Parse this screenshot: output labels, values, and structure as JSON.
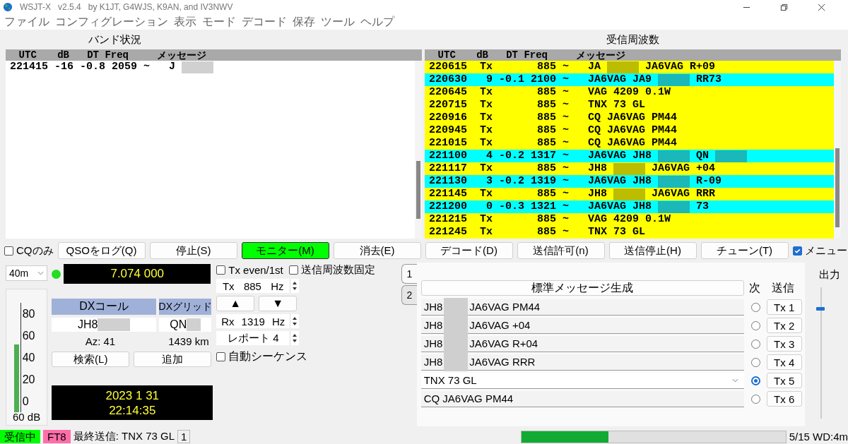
{
  "window": {
    "app": "WSJT-X",
    "version": "v2.5.4",
    "credits": "by K1JT, G4WJS, K9AN, and IV3NWV"
  },
  "menu": [
    "ファイル",
    "コンフィグレーション",
    "表示",
    "モード",
    "デコード",
    "保存",
    "ツール",
    "ヘルプ"
  ],
  "band_activity": {
    "title": "バンド状況",
    "columns": [
      "UTC",
      "dB",
      "DT",
      "Freq",
      "メッセージ"
    ],
    "rows": [
      {
        "kind": "plain",
        "utc": "221415",
        "db": "-16",
        "dt": "-0.8",
        "freq": "2059",
        "sep": "~",
        "message": [
          {
            "kind": "text",
            "text": "J"
          },
          {
            "kind": "redacted"
          }
        ]
      }
    ]
  },
  "rx_frequency": {
    "title": "受信周波数",
    "columns": [
      "UTC",
      "dB",
      "DT",
      "Freq",
      "メッセージ"
    ],
    "rows": [
      {
        "kind": "tx",
        "utc": "220615",
        "db": "Tx",
        "freq": "885",
        "sep": "~",
        "message": [
          {
            "kind": "text",
            "text": "JA"
          },
          {
            "kind": "redacted"
          },
          {
            "kind": "text",
            "text": "JA6VAG R+09"
          }
        ]
      },
      {
        "kind": "rx",
        "utc": "220630",
        "db": "9",
        "dt": "-0.1",
        "freq": "2100",
        "sep": "~",
        "message": [
          {
            "kind": "text",
            "text": "JA6VAG JA9"
          },
          {
            "kind": "redacted"
          },
          {
            "kind": "text",
            "text": "RR73"
          }
        ]
      },
      {
        "kind": "tx",
        "utc": "220645",
        "db": "Tx",
        "freq": "885",
        "sep": "~",
        "message": [
          {
            "kind": "text",
            "text": "VAG 4209 0.1W"
          }
        ]
      },
      {
        "kind": "tx",
        "utc": "220715",
        "db": "Tx",
        "freq": "885",
        "sep": "~",
        "message": [
          {
            "kind": "text",
            "text": "TNX 73 GL"
          }
        ]
      },
      {
        "kind": "tx",
        "utc": "220916",
        "db": "Tx",
        "freq": "885",
        "sep": "~",
        "message": [
          {
            "kind": "text",
            "text": "CQ JA6VAG PM44"
          }
        ]
      },
      {
        "kind": "tx",
        "utc": "220945",
        "db": "Tx",
        "freq": "885",
        "sep": "~",
        "message": [
          {
            "kind": "text",
            "text": "CQ JA6VAG PM44"
          }
        ]
      },
      {
        "kind": "tx",
        "utc": "221015",
        "db": "Tx",
        "freq": "885",
        "sep": "~",
        "message": [
          {
            "kind": "text",
            "text": "CQ JA6VAG PM44"
          }
        ]
      },
      {
        "kind": "rx",
        "utc": "221100",
        "db": "4",
        "dt": "-0.2",
        "freq": "1317",
        "sep": "~",
        "message": [
          {
            "kind": "text",
            "text": "JA6VAG JH8"
          },
          {
            "kind": "redacted"
          },
          {
            "kind": "text",
            "text": "QN"
          },
          {
            "kind": "redacted"
          }
        ]
      },
      {
        "kind": "tx",
        "utc": "221117",
        "db": "Tx",
        "freq": "885",
        "sep": "~",
        "message": [
          {
            "kind": "text",
            "text": "JH8"
          },
          {
            "kind": "redacted"
          },
          {
            "kind": "text",
            "text": "JA6VAG +04"
          }
        ]
      },
      {
        "kind": "rx",
        "utc": "221130",
        "db": "3",
        "dt": "-0.2",
        "freq": "1319",
        "sep": "~",
        "message": [
          {
            "kind": "text",
            "text": "JA6VAG JH8"
          },
          {
            "kind": "redacted"
          },
          {
            "kind": "text",
            "text": "R-09"
          }
        ]
      },
      {
        "kind": "tx",
        "utc": "221145",
        "db": "Tx",
        "freq": "885",
        "sep": "~",
        "message": [
          {
            "kind": "text",
            "text": "JH8"
          },
          {
            "kind": "redacted"
          },
          {
            "kind": "text",
            "text": "JA6VAG RRR"
          }
        ]
      },
      {
        "kind": "rx",
        "utc": "221200",
        "db": "0",
        "dt": "-0.3",
        "freq": "1321",
        "sep": "~",
        "message": [
          {
            "kind": "text",
            "text": "JA6VAG JH8"
          },
          {
            "kind": "redacted"
          },
          {
            "kind": "text",
            "text": "73"
          }
        ]
      },
      {
        "kind": "tx",
        "utc": "221215",
        "db": "Tx",
        "freq": "885",
        "sep": "~",
        "message": [
          {
            "kind": "text",
            "text": "VAG 4209 0.1W"
          }
        ]
      },
      {
        "kind": "tx",
        "utc": "221245",
        "db": "Tx",
        "freq": "885",
        "sep": "~",
        "message": [
          {
            "kind": "text",
            "text": "TNX 73 GL"
          }
        ]
      }
    ]
  },
  "cq_only": {
    "label": "CQのみ",
    "checked": false
  },
  "buttons": [
    {
      "label": "QSOをログ(Q)",
      "on": false
    },
    {
      "label": "停止(S)",
      "on": false
    },
    {
      "label": "モニター(M)",
      "on": true
    },
    {
      "label": "消去(E)",
      "on": false
    },
    {
      "label": "デコード(D)",
      "on": false
    },
    {
      "label": "送信許可(n)",
      "on": false
    },
    {
      "label": "送信停止(H)",
      "on": false
    },
    {
      "label": "チューン(T)",
      "on": false
    }
  ],
  "menu_toggle": {
    "label": "メニュー",
    "checked": true
  },
  "band": {
    "value": "40m"
  },
  "dial": {
    "frequency": "7.074 000"
  },
  "meter": {
    "ticks": [
      "80",
      "60",
      "40",
      "20",
      "0"
    ],
    "level": 0.62,
    "reading": "60 dB"
  },
  "dx": {
    "call_label": "DXコール",
    "grid_label": "DXグリッド",
    "call": "JH8",
    "call_redacted": true,
    "grid": "QN",
    "grid_redacted": true,
    "azimuth": "Az: 41",
    "distance": "1439 km",
    "lookup": "検索(L)",
    "add": "追加"
  },
  "clock": {
    "date": "2023 1 31",
    "time": "22:14:35"
  },
  "tx_even": {
    "label": "Tx even/1st",
    "checked": false
  },
  "hold_tx": {
    "label": "送信周波数固定",
    "checked": false
  },
  "tx_freq": {
    "prefix": "Tx",
    "value": "885",
    "unit": "Hz"
  },
  "arrows": {
    "up": "▲",
    "down": "▼"
  },
  "rx_freq": {
    "prefix": "Rx",
    "value": "1319",
    "unit": "Hz"
  },
  "report": {
    "value": "レポート 4"
  },
  "auto_seq": {
    "label": "自動シーケンス",
    "checked": false
  },
  "tabs": [
    {
      "label": "1",
      "selected": true
    },
    {
      "label": "2",
      "selected": false
    }
  ],
  "messages": {
    "generate": "標準メッセージ生成",
    "next_label": "次",
    "send_label": "送信",
    "rows": [
      {
        "kind": "field",
        "parts": [
          {
            "kind": "text",
            "text": "JH8"
          },
          {
            "kind": "redacted"
          },
          {
            "kind": "text",
            "text": "JA6VAG PM44"
          }
        ],
        "next": false,
        "button": "Tx 1"
      },
      {
        "kind": "field",
        "parts": [
          {
            "kind": "text",
            "text": "JH8"
          },
          {
            "kind": "redacted"
          },
          {
            "kind": "text",
            "text": "JA6VAG +04"
          }
        ],
        "next": false,
        "button": "Tx 2"
      },
      {
        "kind": "field",
        "parts": [
          {
            "kind": "text",
            "text": "JH8"
          },
          {
            "kind": "redacted"
          },
          {
            "kind": "text",
            "text": "JA6VAG R+04"
          }
        ],
        "next": false,
        "button": "Tx 3"
      },
      {
        "kind": "field",
        "parts": [
          {
            "kind": "text",
            "text": "JH8"
          },
          {
            "kind": "redacted"
          },
          {
            "kind": "text",
            "text": "JA6VAG RRR"
          }
        ],
        "next": false,
        "button": "Tx 4"
      },
      {
        "kind": "dropdown",
        "parts": [
          {
            "kind": "text",
            "text": "TNX 73 GL"
          }
        ],
        "next": true,
        "button": "Tx 5"
      },
      {
        "kind": "field",
        "parts": [
          {
            "kind": "text",
            "text": "CQ JA6VAG PM44"
          }
        ],
        "next": false,
        "button": "Tx 6"
      }
    ]
  },
  "power": {
    "label": "出力",
    "level": 0.82
  },
  "status": {
    "badges": [
      {
        "text": "受信中",
        "color": "#00ff00"
      },
      {
        "text": "FT8",
        "color": "#ff6ea8"
      }
    ],
    "last_tx": "最終送信: TNX 73 GL",
    "count": "1",
    "progress": {
      "level": 0.33
    },
    "period": "5/15 WD:4m"
  }
}
